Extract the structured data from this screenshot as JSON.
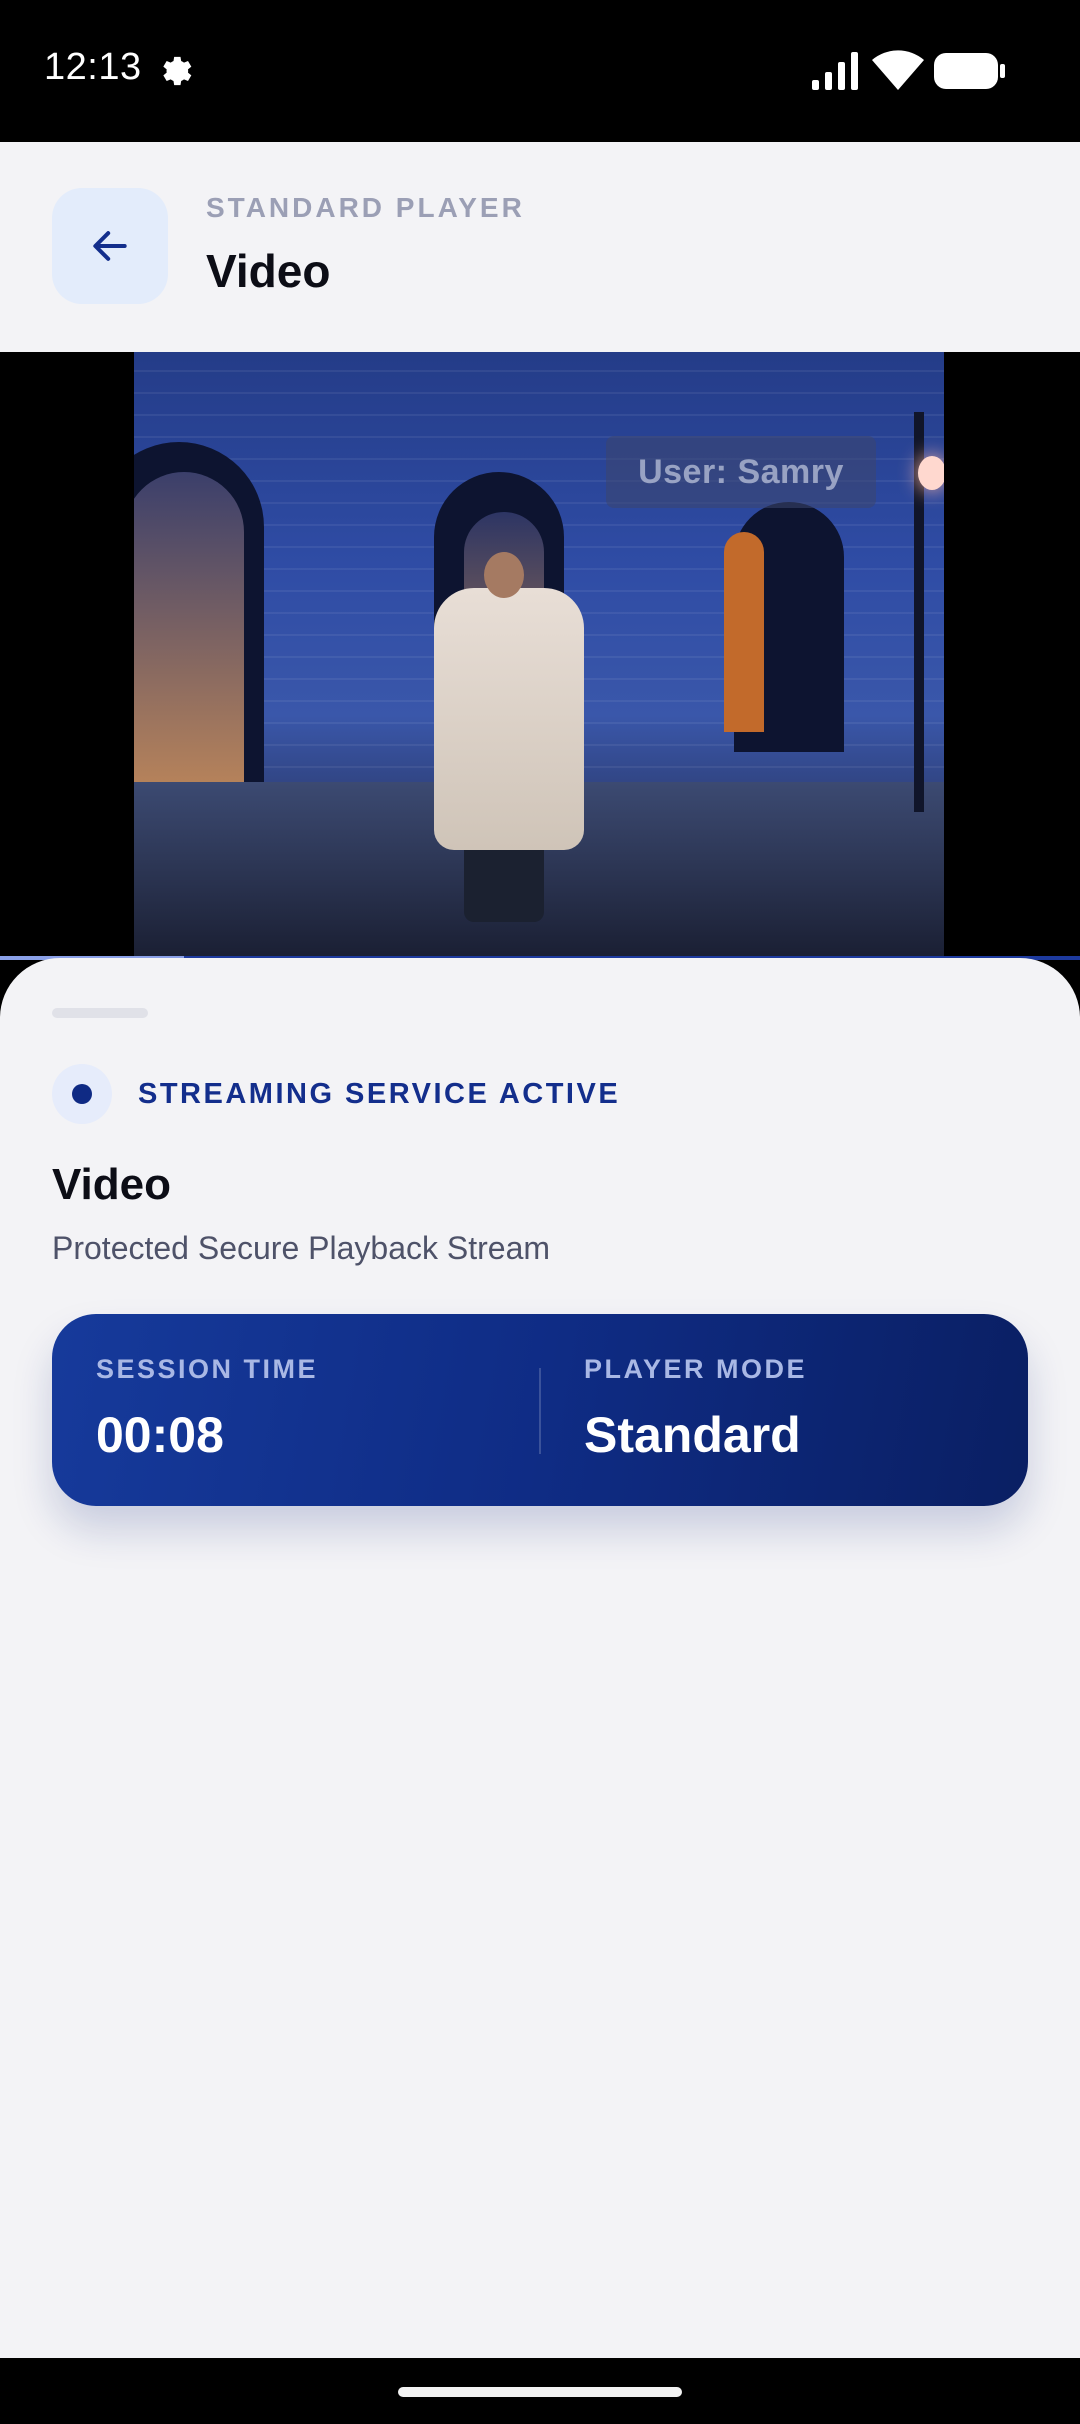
{
  "status_bar": {
    "time": "12:13",
    "icons": [
      "gear-icon",
      "signal-icon",
      "wifi-icon",
      "battery-icon"
    ]
  },
  "header": {
    "kicker": "STANDARD PLAYER",
    "title": "Video",
    "back_icon": "arrow-left-icon"
  },
  "video": {
    "watermark": "User: Samry",
    "progress_fraction": 0.17
  },
  "sheet": {
    "status_text": "STREAMING SERVICE ACTIVE",
    "title": "Video",
    "subtitle": "Protected Secure Playback Stream",
    "stats": {
      "session_label": "SESSION TIME",
      "session_value": "00:08",
      "mode_label": "PLAYER MODE",
      "mode_value": "Standard"
    }
  },
  "colors": {
    "accent": "#132e8c",
    "card_gradient_start": "#163a9b",
    "card_gradient_end": "#0a1f63",
    "background": "#f3f3f6"
  }
}
